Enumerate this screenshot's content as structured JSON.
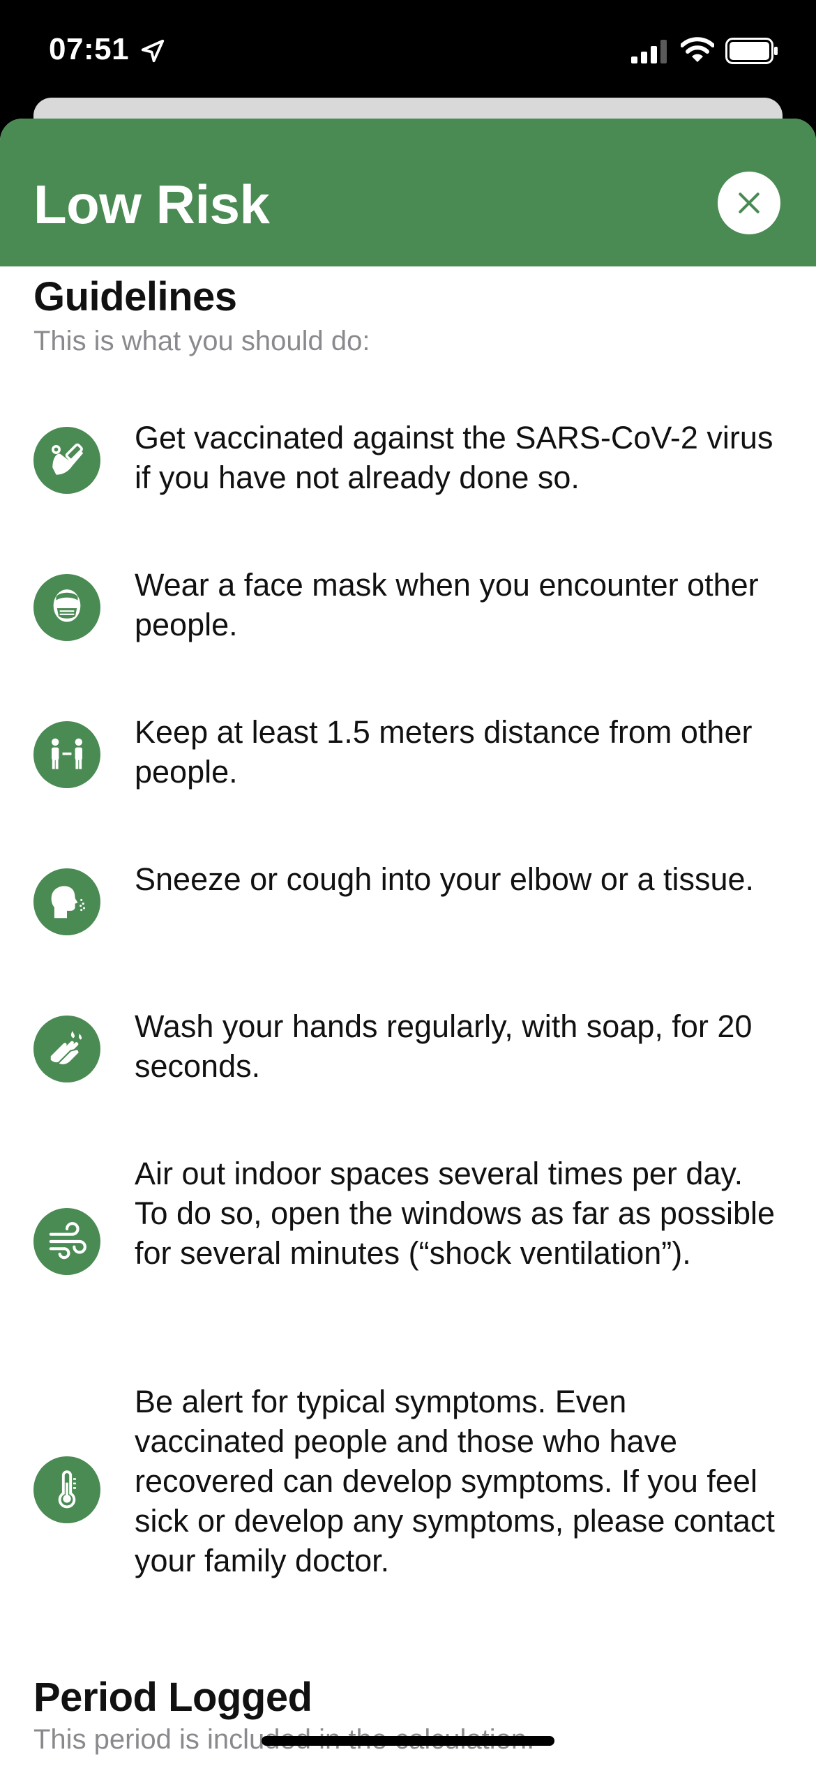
{
  "status_bar": {
    "time": "07:51",
    "icons": [
      "location-arrow-icon",
      "signal-icon",
      "wifi-icon",
      "battery-icon"
    ]
  },
  "sheet": {
    "title": "Low Risk",
    "header_color": "#4a8a53",
    "close_icon": "close-icon"
  },
  "guidelines": {
    "title": "Guidelines",
    "subtitle": "This is what you should do:",
    "items": [
      {
        "icon": "vaccine-icon",
        "text": "Get vaccinated against the SARS-CoV-2 virus if you have not already done so."
      },
      {
        "icon": "face-mask-icon",
        "text": "Wear a face mask when you encounter other people."
      },
      {
        "icon": "distance-icon",
        "text": "Keep at least 1.5 meters distance from other people."
      },
      {
        "icon": "sneeze-icon",
        "text": "Sneeze or cough into your elbow or a tissue."
      },
      {
        "icon": "hand-wash-icon",
        "text": "Wash your hands regularly, with soap, for 20 seconds."
      },
      {
        "icon": "ventilation-icon",
        "text": "Air out indoor spaces several times per day. To do so, open the windows as far as possible for several minutes (“shock ventilation”)."
      },
      {
        "icon": "thermometer-icon",
        "text": "Be alert for typical symptoms. Even vaccinated people and those who have recovered can develop symptoms. If you feel sick or develop any symptoms, please contact your family doctor."
      }
    ]
  },
  "period": {
    "title": "Period Logged",
    "subtitle": "This period is included in the calculation."
  }
}
